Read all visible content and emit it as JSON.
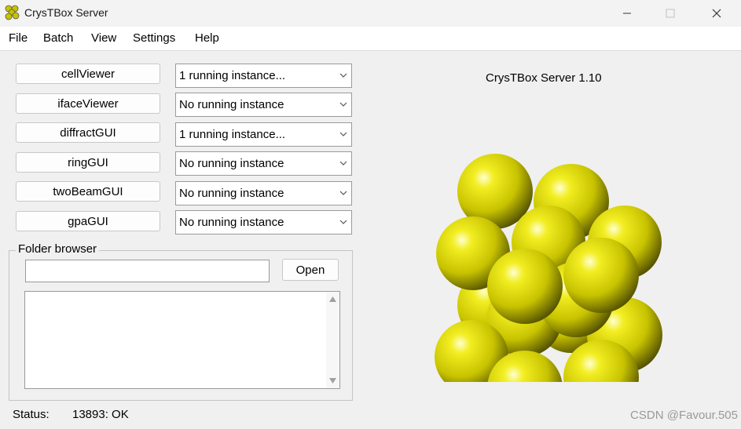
{
  "window": {
    "title": "CrysTBox Server"
  },
  "menu": [
    "File",
    "Batch",
    "View",
    "Settings",
    "Help"
  ],
  "apps": [
    {
      "label": "cellViewer",
      "instances": "1 running instance..."
    },
    {
      "label": "ifaceViewer",
      "instances": "No running instance"
    },
    {
      "label": "diffractGUI",
      "instances": "1 running instance..."
    },
    {
      "label": "ringGUI",
      "instances": "No running instance"
    },
    {
      "label": "twoBeamGUI",
      "instances": "No running instance"
    },
    {
      "label": "gpaGUI",
      "instances": "No running instance"
    }
  ],
  "folder_browser": {
    "label": "Folder browser",
    "path": "",
    "open_label": "Open"
  },
  "server_title": "CrysTBox Server 1.10",
  "status": {
    "label": "Status:",
    "value": "13893: OK"
  },
  "watermark": "CSDN @Favour.505",
  "colors": {
    "sphere": "#c8c300",
    "sphere_highlight": "#ffffd0",
    "sphere_shadow": "#4a4800"
  },
  "icons": {
    "app": "crystal-logo-icon",
    "minimize": "minimize-icon",
    "maximize": "maximize-icon",
    "close": "close-icon",
    "dropdown": "chevron-down-icon"
  }
}
